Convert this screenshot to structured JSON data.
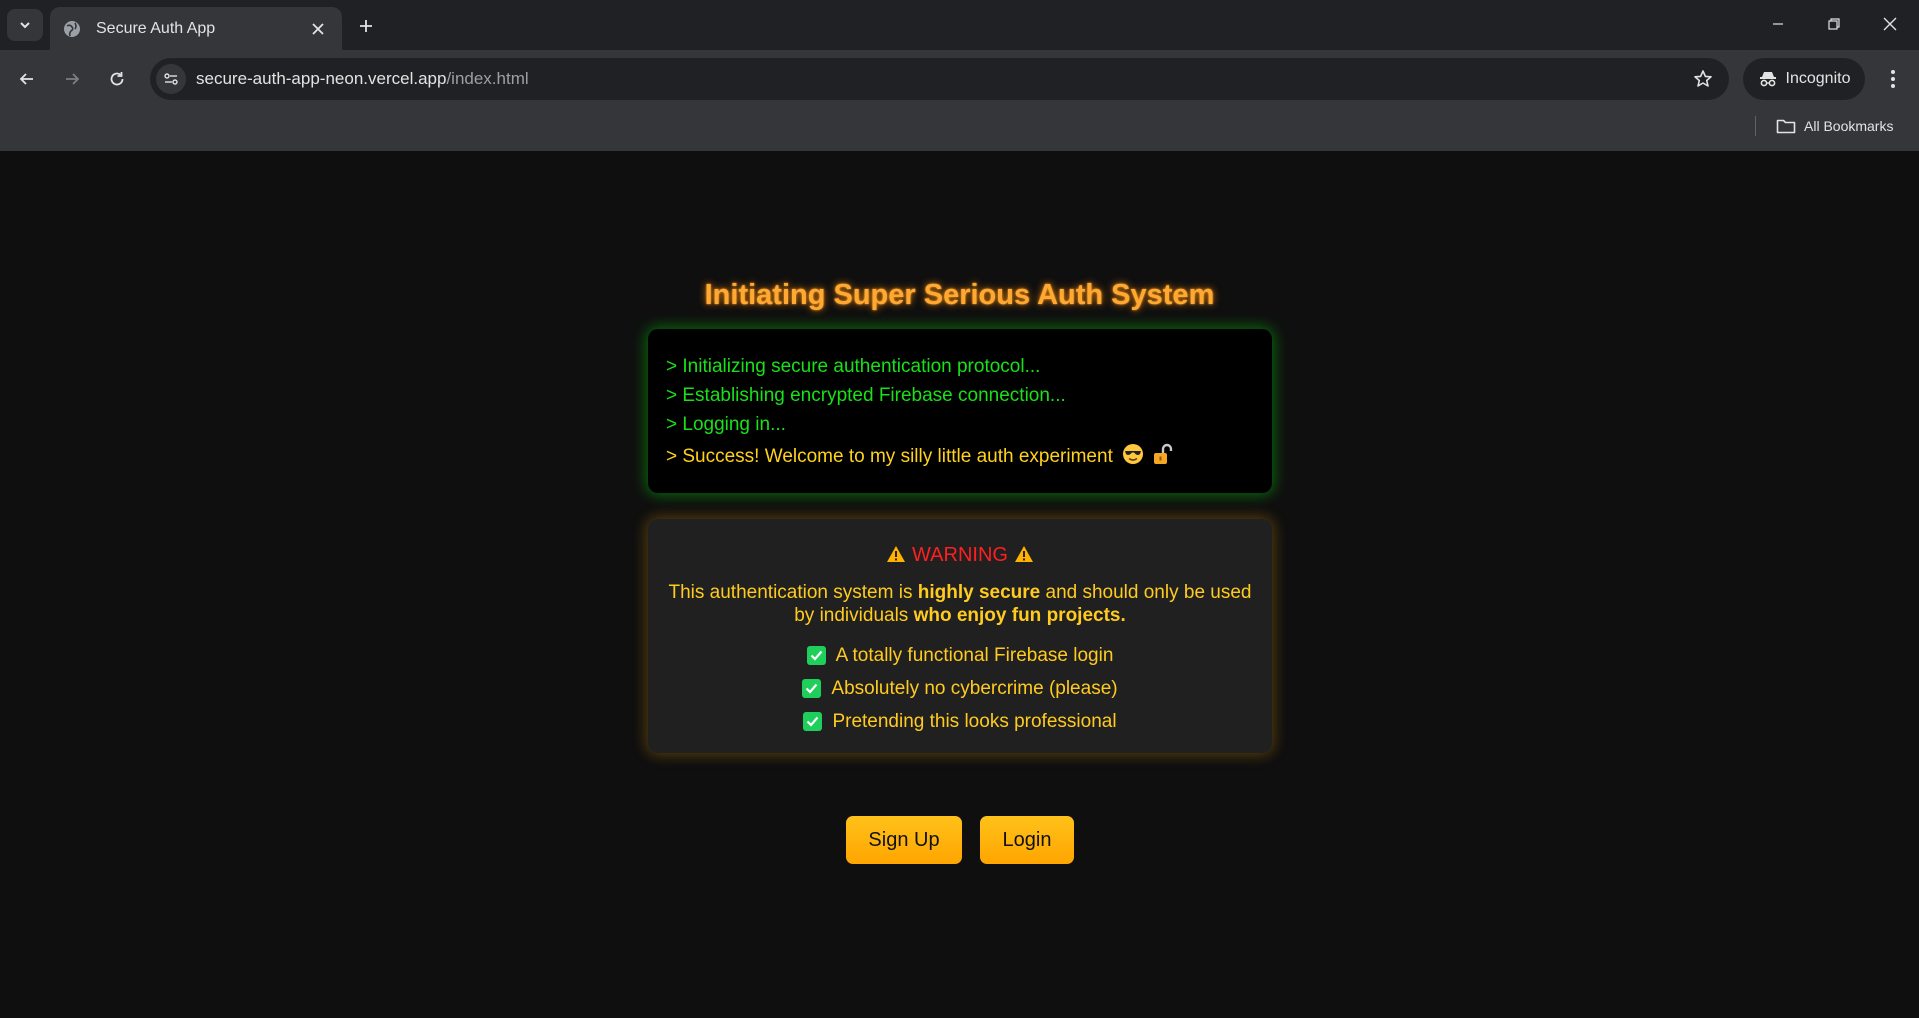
{
  "browser": {
    "tab_title": "Secure Auth App",
    "url_host": "secure-auth-app-neon.vercel.app",
    "url_path": "/index.html",
    "incognito_label": "Incognito",
    "bookmarks_label": "All Bookmarks"
  },
  "page": {
    "heading": "Initiating Super Serious Auth System",
    "terminal": {
      "lines": [
        "> Initializing secure authentication protocol...",
        "> Establishing encrypted Firebase connection...",
        "> Logging in..."
      ],
      "success": "> Success! Welcome to my silly little auth experiment",
      "success_icons": [
        "sunglasses-face-emoji",
        "unlocked-padlock-emoji"
      ]
    },
    "warning": {
      "title": "WARNING",
      "text_1": "This authentication system is ",
      "bold_1": "highly secure",
      "text_2": " and should only be used by individuals ",
      "bold_2": "who enjoy fun projects.",
      "checklist": [
        "A totally functional Firebase login",
        "Absolutely no cybercrime (please)",
        "Pretending this looks professional"
      ]
    },
    "buttons": {
      "signup": "Sign Up",
      "login": "Login"
    }
  },
  "colors": {
    "heading": "#ffa933",
    "terminal_text": "#19e019",
    "success_text": "#ffd21c",
    "warning_title": "#ff1f1f",
    "warning_text": "#ffcb1f",
    "checkbox": "#1fcf5b",
    "button": "#ffb30f"
  }
}
